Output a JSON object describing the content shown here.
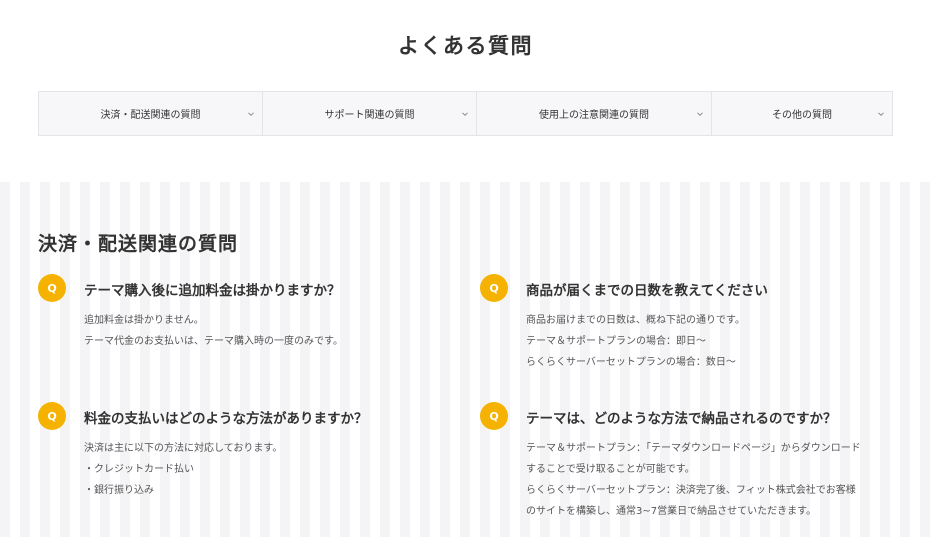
{
  "page": {
    "title": "よくある質問"
  },
  "tabs": [
    {
      "label": "決済・配送関連の質問"
    },
    {
      "label": "サポート関連の質問"
    },
    {
      "label": "使用上の注意関連の質問"
    },
    {
      "label": "その他の質問"
    }
  ],
  "section": {
    "title": "決済・配送関連の質問",
    "badge": "Q",
    "items": [
      {
        "question": "テーマ購入後に追加料金は掛かりますか？",
        "answer": [
          "追加料金は掛かりません。",
          "テーマ代金のお支払いは、テーマ購入時の一度のみです。"
        ]
      },
      {
        "question": "商品が届くまでの日数を教えてください",
        "answer": [
          "商品お届けまでの日数は、概ね下記の通りです。",
          "テーマ＆サポートプランの場合：即日～",
          "らくらくサーバーセットプランの場合：数日～"
        ]
      },
      {
        "question": "料金の支払いはどのような方法がありますか？",
        "answer": [
          "決済は主に以下の方法に対応しております。",
          "・クレジットカード払い",
          "・銀行振り込み"
        ]
      },
      {
        "question": "テーマは、どのような方法で納品されるのですか？",
        "answer": [
          "テーマ＆サポートプラン：「テーマダウンロードページ」からダウンロード",
          "することで受け取ることが可能です。",
          "らくらくサーバーセットプラン：決済完了後、フィット株式会社でお客様",
          "のサイトを構築し、通常3~7営業日で納品させていただきます。"
        ]
      }
    ]
  },
  "colors": {
    "accent": "#f5b200",
    "text": "#333333",
    "tab_bg": "#f7f7fa"
  },
  "icons": {
    "tab_chevron": "chevron-down-icon"
  }
}
